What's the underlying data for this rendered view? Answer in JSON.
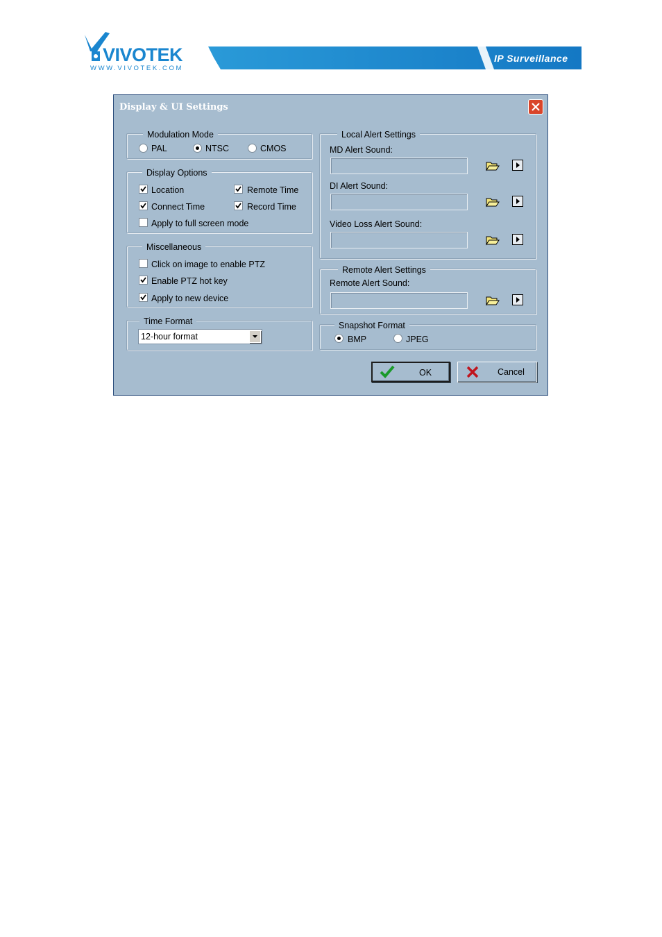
{
  "header": {
    "brand": "VIVOTEK",
    "website": "WWW.VIVOTEK.COM",
    "tagline": "IP Surveillance",
    "brand_color": "#1e90d6"
  },
  "dialog": {
    "title": "Display & UI Settings",
    "background": "#a6bccf",
    "modulation_mode": {
      "legend": "Modulation Mode",
      "options": [
        "PAL",
        "NTSC",
        "CMOS"
      ],
      "selected": "NTSC"
    },
    "display_options": {
      "legend": "Display Options",
      "location": {
        "label": "Location",
        "checked": true
      },
      "remote_time": {
        "label": "Remote Time",
        "checked": true
      },
      "connect_time": {
        "label": "Connect Time",
        "checked": true
      },
      "record_time": {
        "label": "Record Time",
        "checked": true
      },
      "full_screen": {
        "label": "Apply to full screen mode",
        "checked": false
      }
    },
    "miscellaneous": {
      "legend": "Miscellaneous",
      "click_ptz": {
        "label": "Click on image to enable PTZ",
        "checked": false
      },
      "ptz_hot_key": {
        "label": "Enable PTZ hot key",
        "checked": true
      },
      "new_device": {
        "label": "Apply to new device",
        "checked": true
      }
    },
    "time_format": {
      "legend": "Time Format",
      "selected": "12-hour format"
    },
    "local_alert": {
      "legend": "Local Alert Settings",
      "md_label": "MD Alert Sound:",
      "md_value": "",
      "di_label": "DI Alert Sound:",
      "di_value": "",
      "video_loss_label": "Video Loss Alert Sound:",
      "video_loss_value": ""
    },
    "remote_alert": {
      "legend": "Remote Alert Settings",
      "label": "Remote Alert Sound:",
      "value": ""
    },
    "snapshot_format": {
      "legend": "Snapshot Format",
      "options": [
        "BMP",
        "JPEG"
      ],
      "selected": "BMP"
    },
    "buttons": {
      "ok": "OK",
      "cancel": "Cancel"
    }
  }
}
